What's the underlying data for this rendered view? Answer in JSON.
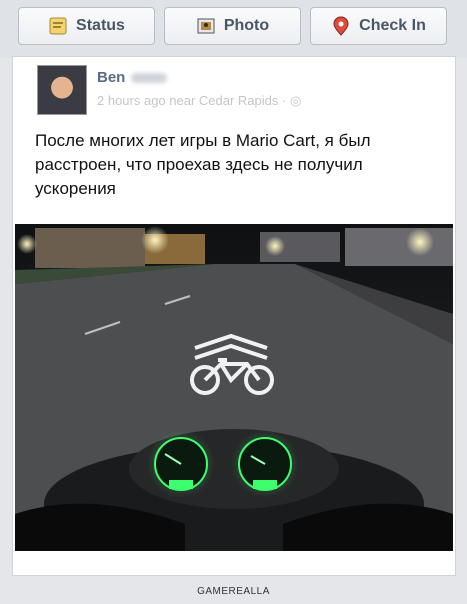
{
  "tabs": [
    {
      "label": "Status",
      "icon": "status-icon"
    },
    {
      "label": "Photo",
      "icon": "photo-icon"
    },
    {
      "label": "Check In",
      "icon": "location-pin-icon"
    }
  ],
  "post": {
    "author_first": "Ben",
    "time": "2 hours ago near Cedar Rapids",
    "text": "После многих лет игры в Mario Cart, я был расстроен, что проехав здесь не получил ускорения"
  },
  "footer": "GAMEREALLA",
  "colors": {
    "tab_text": "#4b5565",
    "author": "#5c6b84",
    "meta": "#c4c6cb",
    "gauge": "#3cff6e"
  }
}
